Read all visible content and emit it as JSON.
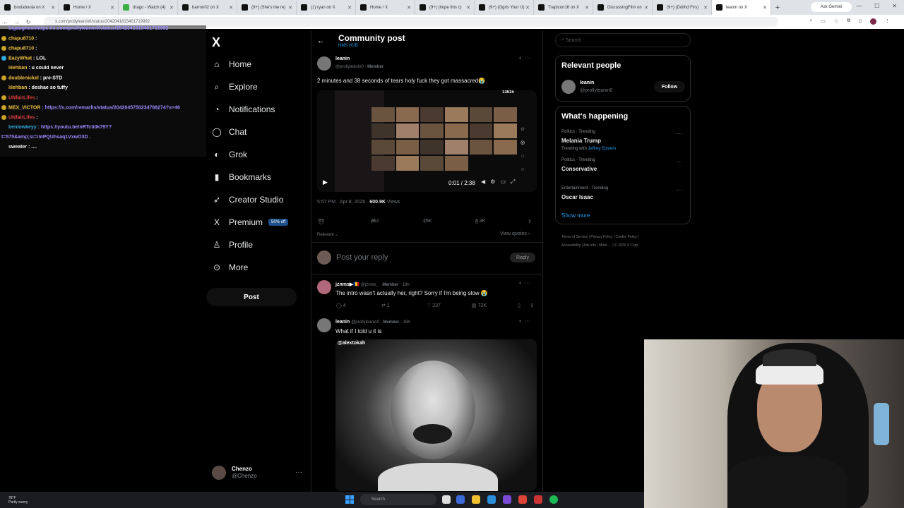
{
  "browser": {
    "tabs": [
      {
        "label": "boolaboola on X",
        "color": "#111111"
      },
      {
        "label": "Home / X",
        "color": "#111111"
      },
      {
        "label": "drago - Watch (4)",
        "color": "#3cb043"
      },
      {
        "label": "barron02 on X",
        "color": "#111111"
      },
      {
        "label": "(9+) (She's the re)",
        "color": "#111111"
      },
      {
        "label": "(1) ryan on X",
        "color": "#111111"
      },
      {
        "label": "Home / X",
        "color": "#111111"
      },
      {
        "label": "(9+) (hope this c)",
        "color": "#111111"
      },
      {
        "label": "(9+) (Ogris Your U)",
        "color": "#111111"
      },
      {
        "label": "TrapIcon16 on X",
        "color": "#111111"
      },
      {
        "label": "DiscussingFilm on",
        "color": "#111111"
      },
      {
        "label": "(9+) (Dollhd Firs)",
        "color": "#111111"
      },
      {
        "label": "leanin on X",
        "color": "#111111"
      }
    ],
    "ask_button": "Ask Gemini",
    "url": "x.com/prollyleanin0/status/2042041815401719992"
  },
  "chat": {
    "lines": [
      {
        "name": "bigaughesh",
        "name_color": "#9b8cff",
        "message": "https://x.com/prollyleanin0/status/2042041815401719992",
        "is_link": true,
        "badge": ""
      },
      {
        "name": "chapu8710",
        "name_color": "#f0c040",
        "message": " :",
        "is_link": false,
        "badge": "#c9a227"
      },
      {
        "name": "chapu8710",
        "name_color": "#f0c040",
        "message": " :",
        "is_link": false,
        "badge": "#c9a227"
      },
      {
        "name": "EazyWhat",
        "name_color": "#f0c040",
        "message": " : LOL",
        "is_link": false,
        "badge": "#2fa8e0"
      },
      {
        "name": "lilehban",
        "name_color": "#f0c040",
        "message": " : u could never",
        "is_link": false,
        "badge": ""
      },
      {
        "name": "doublenickel",
        "name_color": "#f0c040",
        "message": " : pre-STD",
        "is_link": false,
        "badge": "#c9a227"
      },
      {
        "name": "lilehban",
        "name_color": "#f0c040",
        "message": " : deshae so tuffy",
        "is_link": false,
        "badge": ""
      },
      {
        "name": "UNfairLifes",
        "name_color": "#e04040",
        "message": " :",
        "is_link": false,
        "badge": "#c9a227"
      },
      {
        "name": "MEX_VICTOR",
        "name_color": "#f0c040",
        "message": " : https://x.com/remarks/status/2042045750234788274?s=46",
        "is_link": true,
        "badge": "#c9a227"
      },
      {
        "name": "UNfairLifes",
        "name_color": "#e04040",
        "message": " :",
        "is_link": false,
        "badge": "#c9a227"
      },
      {
        "name": "benlowkeyy",
        "name_color": "#2fa8e0",
        "message": " : https://youtu.be/nRTcti0k79Y?",
        "is_link": true,
        "badge": ""
      },
      {
        "name": "",
        "name_color": "#9b8cff",
        "message": "t=575&amp;si=rmPQUhsaq1VxwO3D .",
        "is_link": true,
        "badge": ""
      },
      {
        "name": "sweater",
        "name_color": "#f0f0f0",
        "message": " : ....",
        "is_link": false,
        "badge": ""
      }
    ]
  },
  "nav": {
    "items": [
      {
        "label": "Home",
        "icon": "home-icon",
        "glyph": "⌂"
      },
      {
        "label": "Explore",
        "icon": "search-icon",
        "glyph": "⌕"
      },
      {
        "label": "Notifications",
        "icon": "bell-icon",
        "glyph": "◔"
      },
      {
        "label": "Chat",
        "icon": "chat-icon",
        "glyph": "◯"
      },
      {
        "label": "Grok",
        "icon": "grok-icon",
        "glyph": "◐"
      },
      {
        "label": "Bookmarks",
        "icon": "bookmark-icon",
        "glyph": "▮"
      },
      {
        "label": "Creator Studio",
        "icon": "rocket-icon",
        "glyph": "➶"
      },
      {
        "label": "Premium",
        "icon": "x-logo-icon",
        "glyph": "X"
      },
      {
        "label": "Profile",
        "icon": "person-icon",
        "glyph": "♙"
      },
      {
        "label": "More",
        "icon": "more-circle-icon",
        "glyph": "⊙"
      }
    ],
    "premium_badge": "50% off",
    "post_button": "Post",
    "account": {
      "name": "Chenzo",
      "handle": "@Chenzo"
    }
  },
  "main": {
    "title": "Community post",
    "subtitle": "NMS HUB",
    "post": {
      "name": "leanin",
      "handle": "@prollyleanin0",
      "member": "Member",
      "text": "2 minutes and 38 seconds of tears holy fuck they got massacred😭",
      "video_time": "0:01 / 2:38",
      "video_count": "13615",
      "timestamp": "5:57 PM · Apr 8, 2026 · ",
      "views_number": "600.9K",
      "views_label": " Views",
      "replies": "57",
      "reposts": "262",
      "likes": "15K",
      "bookmarks": "4.3K",
      "relevant": "Relevant",
      "view_quotes": "View quotes"
    },
    "reply": {
      "placeholder": "Post your reply",
      "button": "Reply"
    },
    "comments": [
      {
        "name": "jznms▶🇷🇴",
        "handle": "@jznms_",
        "member": "Member",
        "time": "18h",
        "text": "The intro wasn't actually her, right? Sorry if I'm being slow 😭",
        "replies": "4",
        "reposts": "1",
        "likes": "237",
        "views": "72K"
      },
      {
        "name": "leanin",
        "handle": "@prollyleanin0",
        "member": "Member",
        "time": "16h",
        "text": "What if I told u it is",
        "video_label": "@alextokah"
      }
    ]
  },
  "right": {
    "search_placeholder": "Search",
    "relevant_title": "Relevant people",
    "relevant_person": {
      "name": "leanin",
      "handle": "@prollyleanin0",
      "follow": "Follow"
    },
    "happening_title": "What's happening",
    "trends": [
      {
        "meta": "Politics · Trending",
        "name": "Melania Trump",
        "extra_prefix": "Trending with ",
        "extra_link": "Jeffrey Epstein"
      },
      {
        "meta": "Politics · Trending",
        "name": "Conservative",
        "extra_prefix": "",
        "extra_link": ""
      },
      {
        "meta": "Entertainment · Trending",
        "name": "Oscar Isaac",
        "extra_prefix": "",
        "extra_link": ""
      }
    ],
    "show_more": "Show more",
    "footer_line1": "Terms of Service  |  Privacy Policy  |  Cookie Policy  |",
    "footer_line2": "Accessibility  |  Ads info  |  More …  |  © 2026 X Corp."
  },
  "taskbar": {
    "weather_temp": "78°F",
    "weather_desc": "Partly sunny",
    "search": "Search"
  }
}
